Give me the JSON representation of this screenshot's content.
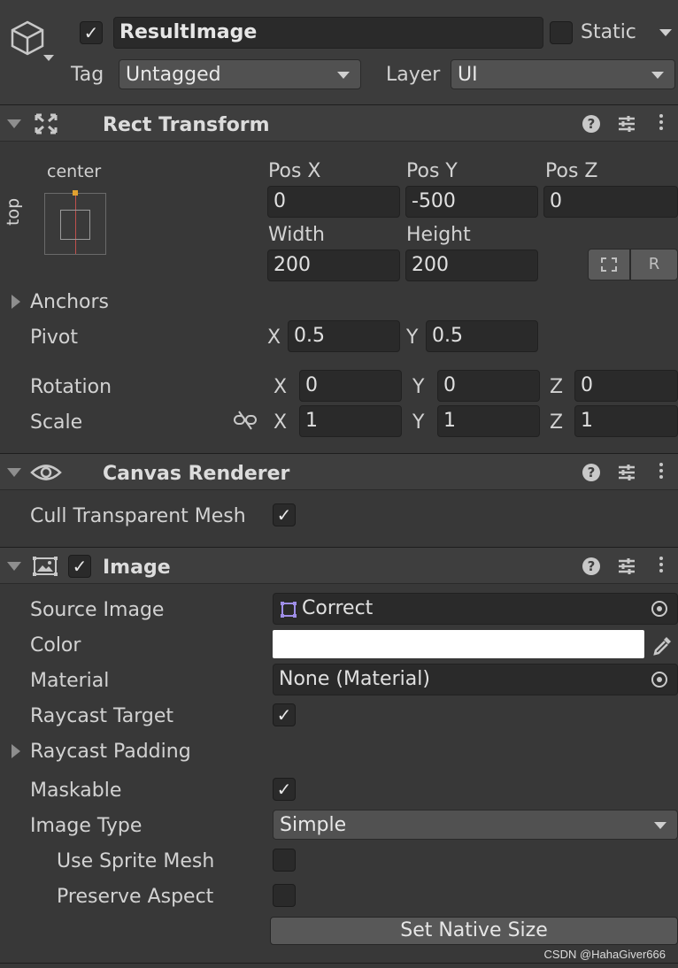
{
  "gameobject": {
    "active_check": "✓",
    "name": "ResultImage",
    "static_label": "Static",
    "tag_label": "Tag",
    "tag_value": "Untagged",
    "layer_label": "Layer",
    "layer_value": "UI"
  },
  "rect_transform": {
    "title": "Rect Transform",
    "anchor_h": "center",
    "anchor_v": "top",
    "pos_x_label": "Pos X",
    "pos_y_label": "Pos Y",
    "pos_z_label": "Pos Z",
    "pos_x": "0",
    "pos_y": "-500",
    "pos_z": "0",
    "width_label": "Width",
    "height_label": "Height",
    "width": "200",
    "height": "200",
    "raw_edit": "R",
    "anchors_label": "Anchors",
    "pivot_label": "Pivot",
    "pivot_x_label": "X",
    "pivot_y_label": "Y",
    "pivot_x": "0.5",
    "pivot_y": "0.5",
    "rotation_label": "Rotation",
    "scale_label": "Scale",
    "x_label": "X",
    "y_label": "Y",
    "z_label": "Z",
    "rot_x": "0",
    "rot_y": "0",
    "rot_z": "0",
    "scale_x": "1",
    "scale_y": "1",
    "scale_z": "1"
  },
  "canvas_renderer": {
    "title": "Canvas Renderer",
    "cull_label": "Cull Transparent Mesh",
    "cull_check": "✓"
  },
  "image": {
    "title": "Image",
    "enabled_check": "✓",
    "source_label": "Source Image",
    "source_value": "Correct",
    "color_label": "Color",
    "color_value": "#ffffff",
    "material_label": "Material",
    "material_value": "None (Material)",
    "raycast_target_label": "Raycast Target",
    "raycast_target_check": "✓",
    "raycast_padding_label": "Raycast Padding",
    "maskable_label": "Maskable",
    "maskable_check": "✓",
    "image_type_label": "Image Type",
    "image_type_value": "Simple",
    "use_sprite_mesh_label": "Use Sprite Mesh",
    "preserve_aspect_label": "Preserve Aspect",
    "native_size_button": "Set Native Size"
  },
  "help_glyph": "?",
  "watermark": "CSDN @HahaGiver666"
}
